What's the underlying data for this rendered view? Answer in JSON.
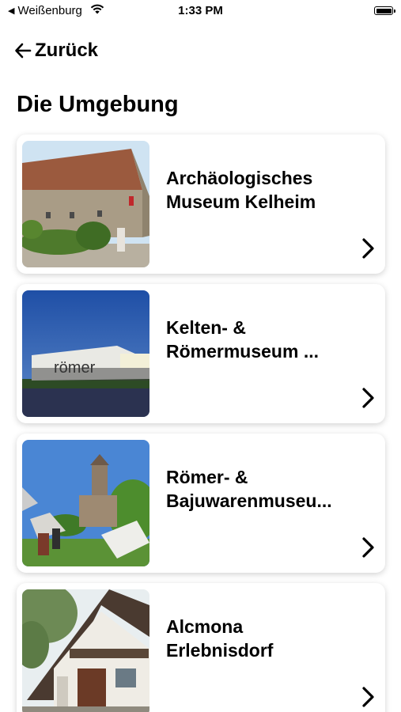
{
  "status_bar": {
    "back_app": "Weißenburg",
    "time": "1:33 PM",
    "icons": [
      "wifi-icon",
      "battery-icon"
    ]
  },
  "nav": {
    "back_label": "Zurück"
  },
  "page": {
    "title": "Die Umgebung"
  },
  "cards": [
    {
      "title": "Archäologisches\nMuseum Kelheim",
      "image": "museum-kelheim-photo"
    },
    {
      "title": "Kelten- &\nRömermuseum ...",
      "image": "roemermuseum-photo",
      "image_sign": "römer"
    },
    {
      "title": "Römer- &\nBajuwarenmuseu...",
      "image": "burg-photo"
    },
    {
      "title": "Alcmona\nErlebnisdorf",
      "image": "erlebnisdorf-photo"
    }
  ]
}
